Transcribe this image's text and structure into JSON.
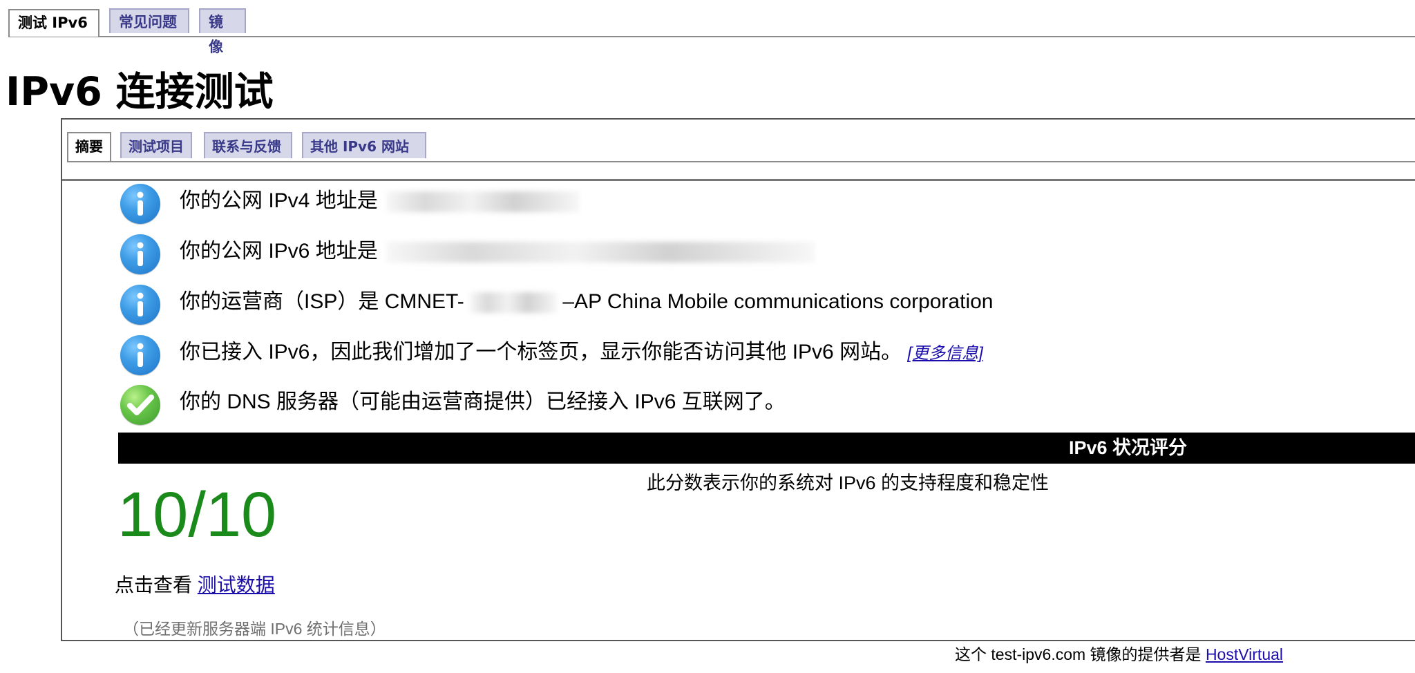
{
  "top_tabs": [
    "测试 IPv6",
    "常见问题",
    "镜像"
  ],
  "title": "IPv6 连接测试",
  "sub_tabs": [
    "摘要",
    "测试项目",
    "联系与反馈",
    "其他 IPv6 网站"
  ],
  "info_rows": [
    {
      "icon": "info-icon",
      "text": "你的公网 IPv4 地址是"
    },
    {
      "icon": "info-icon",
      "text": "你的公网 IPv6 地址是"
    },
    {
      "icon": "info-icon",
      "text_before": "你的运营商（ISP）是 CMNET-",
      "text_after": "–AP China Mobile communications corporation"
    },
    {
      "icon": "info-icon",
      "text": "你已接入 IPv6，因此我们增加了一个标签页，显示你能否访问其他 IPv6 网站。",
      "link": "[更多信息]"
    },
    {
      "icon": "success-icon",
      "text": "你的 DNS 服务器（可能由运营商提供）已经接入 IPv6 互联网了。"
    }
  ],
  "score": {
    "title": "IPv6 状况评分",
    "description": "此分数表示你的系统对 IPv6 的支持程度和稳定性",
    "value": "10/10"
  },
  "view_data": {
    "prefix": "点击查看",
    "link": "测试数据"
  },
  "stats_note": "（已经更新服务器端 IPv6 统计信息）",
  "footer": {
    "prefix": "这个 test-ipv6.com 镜像的提供者是",
    "link": "HostVirtual"
  },
  "colors": {
    "tab_bg": "#d7d7ea",
    "tab_text": "#39398a",
    "score_green": "#1a8a1a",
    "link_blue": "#1a0dab",
    "banner_black": "#000000"
  }
}
